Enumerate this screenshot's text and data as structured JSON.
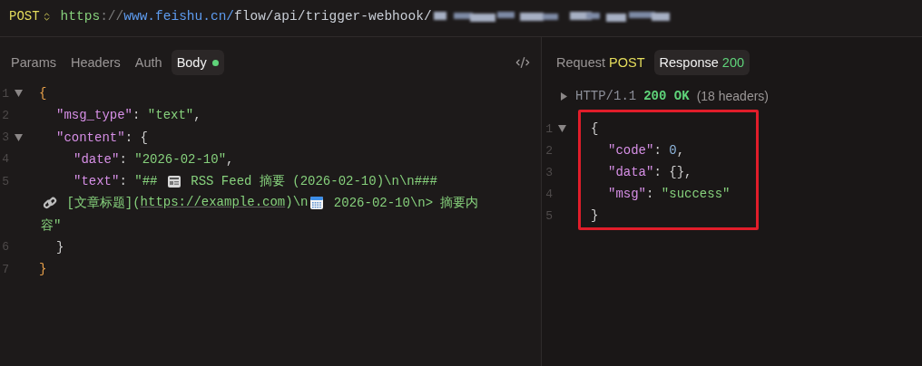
{
  "request": {
    "method": "POST",
    "url": [
      {
        "kind": "scheme",
        "text": "https"
      },
      {
        "kind": "sep",
        "text": "://"
      },
      {
        "kind": "host",
        "text": "www.feishu.cn/"
      },
      {
        "kind": "path",
        "text": "flow/api/trigger-webhook/"
      }
    ],
    "redacted_tail": true
  },
  "request_panel": {
    "tabs": [
      {
        "label": "Params",
        "selected": false,
        "indicator": false
      },
      {
        "label": "Headers",
        "selected": false,
        "indicator": false
      },
      {
        "label": "Auth",
        "selected": false,
        "indicator": false
      },
      {
        "label": "Body",
        "selected": true,
        "indicator": true
      }
    ],
    "lines": [
      {
        "number": "1",
        "fold": true,
        "tokens": [
          {
            "kind": "outer",
            "text": "{"
          }
        ],
        "children": [
          {
            "number": "2",
            "fold": false,
            "tokens": [
              {
                "kind": "key",
                "text": "\"msg_type\""
              },
              {
                "kind": "punct",
                "text": ": "
              },
              {
                "kind": "string",
                "text": "\"text\""
              },
              {
                "kind": "punct",
                "text": ","
              }
            ]
          },
          {
            "number": "3",
            "fold": true,
            "tokens": [
              {
                "kind": "key",
                "text": "\"content\""
              },
              {
                "kind": "punct",
                "text": ": {"
              }
            ],
            "children": [
              {
                "number": "4",
                "fold": false,
                "tokens": [
                  {
                    "kind": "key",
                    "text": "\"date\""
                  },
                  {
                    "kind": "punct",
                    "text": ": "
                  },
                  {
                    "kind": "string",
                    "text": "\"2026-02-10\""
                  },
                  {
                    "kind": "punct",
                    "text": ","
                  }
                ]
              },
              {
                "number": "5",
                "fold": false,
                "tokens": [
                  {
                    "kind": "key",
                    "text": "\"text\""
                  },
                  {
                    "kind": "punct",
                    "text": ": "
                  },
                  {
                    "kind": "string",
                    "text": "\"## "
                  },
                  {
                    "kind": "icon"
                  },
                  {
                    "kind": "string",
                    "text": " RSS Feed 摘要 (2026-02-10)\\n\\n###"
                  }
                ],
                "wraps": [
                  {
                    "tokens": [
                      {
                        "kind": "icon"
                      },
                      {
                        "kind": "string",
                        "text": " [文章标题]("
                      },
                      {
                        "kind": "link",
                        "text": "https://example.com"
                      },
                      {
                        "kind": "string",
                        "text": ")\\n"
                      },
                      {
                        "kind": "icon"
                      },
                      {
                        "kind": "string",
                        "text": " 2026-02-10\\n> 摘要内"
                      }
                    ]
                  },
                  {
                    "tokens": [
                      {
                        "kind": "string",
                        "text": "容\""
                      }
                    ]
                  }
                ]
              }
            ]
          },
          {
            "number": "6",
            "fold": false,
            "tokens": [
              {
                "kind": "punct",
                "text": "}"
              }
            ]
          }
        ]
      },
      {
        "number": "7",
        "fold": false,
        "tokens": [
          {
            "kind": "outer",
            "text": "}"
          }
        ]
      }
    ]
  },
  "response_panel": {
    "tabs": [
      {
        "label": "Request",
        "badge": "POST",
        "color": "#e4dc5c",
        "selected": false
      },
      {
        "label": "Response",
        "badge": "200",
        "color": "#5fd47a",
        "selected": true
      }
    ],
    "status": {
      "expanded": false,
      "protocol": "HTTP/1.1",
      "code": "200 OK",
      "headers": "(18 headers)"
    },
    "highlighted": true,
    "lines": [
      {
        "number": "1",
        "fold": true,
        "tokens": [
          {
            "kind": "punct",
            "text": "{"
          }
        ],
        "children": [
          {
            "number": "2",
            "fold": false,
            "tokens": [
              {
                "kind": "key",
                "text": "\"code\""
              },
              {
                "kind": "punct",
                "text": ": "
              },
              {
                "kind": "number",
                "text": "0"
              },
              {
                "kind": "punct",
                "text": ","
              }
            ]
          },
          {
            "number": "3",
            "fold": false,
            "tokens": [
              {
                "kind": "key",
                "text": "\"data\""
              },
              {
                "kind": "punct",
                "text": ": {},"
              }
            ]
          },
          {
            "number": "4",
            "fold": false,
            "tokens": [
              {
                "kind": "key",
                "text": "\"msg\""
              },
              {
                "kind": "punct",
                "text": ": "
              },
              {
                "kind": "string",
                "text": "\"success\""
              }
            ]
          }
        ]
      },
      {
        "number": "5",
        "fold": false,
        "tokens": [
          {
            "kind": "punct",
            "text": "}"
          }
        ]
      }
    ]
  }
}
